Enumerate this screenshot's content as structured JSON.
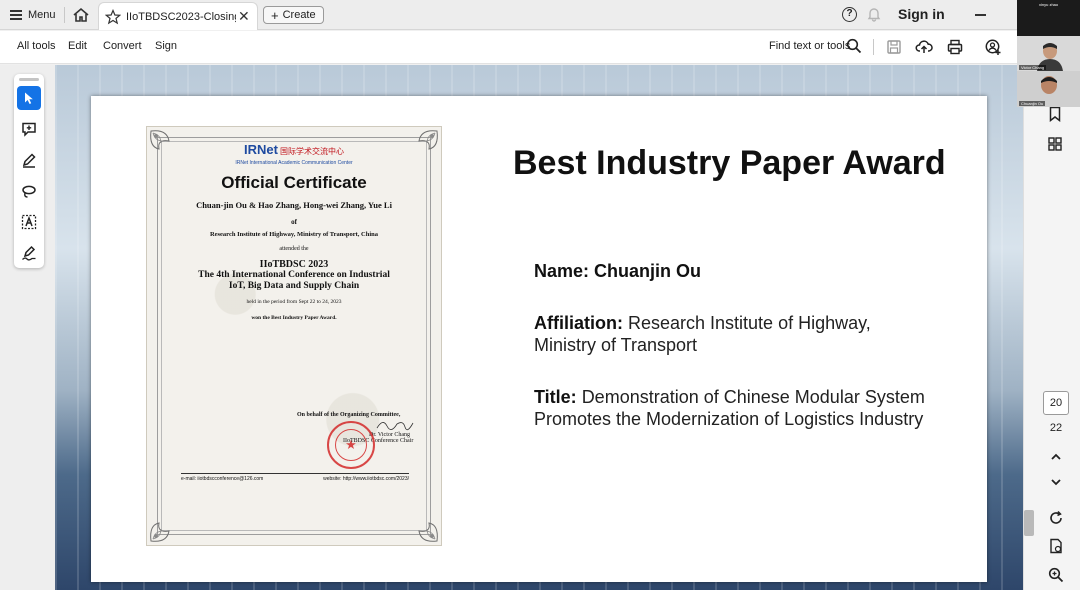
{
  "tabbar": {
    "menu_label": "Menu",
    "tab_title": "IIoTBDSC2023-Closing C...",
    "create_label": "Create",
    "signin_label": "Sign in"
  },
  "toolsbar": {
    "items": [
      "All tools",
      "Edit",
      "Convert",
      "Sign"
    ],
    "find_label": "Find text or tools"
  },
  "certificate": {
    "brand": "IRNet",
    "brand_cn": "国际学术交流中心",
    "brand_sub": "IRNet International Academic Communication Center",
    "title": "Official Certificate",
    "authors": "Chuan-jin Ou & Hao Zhang, Hong-wei Zhang, Yue Li",
    "of": "of",
    "institution": "Research Institute of Highway, Ministry of Transport, China",
    "attended": "attended the",
    "conf_short": "IIoTBDSC 2023",
    "conf_line1": "The 4th International Conference on Industrial",
    "conf_line2": "IoT, Big Data and Supply Chain",
    "held": "held in the period from Sept 22 to 24, 2023",
    "won": "won the Best Industry Paper Award.",
    "behalf": "On behalf of the Organizing Committee,",
    "signer": "Dr. Victor Chang",
    "signer_role": "IIoTBDSC Conference Chair",
    "email": "e-mail: iiotbdscconference@126.com",
    "website": "website: http://www.iiotbdsc.com/2023/"
  },
  "award": {
    "title": "Best Industry Paper Award",
    "name_label": "Name:",
    "name_value": "Chuanjin Ou",
    "affiliation_label": "Affiliation:",
    "affiliation_line1": "Research Institute of Highway,",
    "affiliation_line2": "Ministry of Transport",
    "title_label": "Title:",
    "title_line1": "Demonstration of Chinese Modular System",
    "title_line2": "Promotes the Modernization of Logistics Industry"
  },
  "pagination": {
    "current": "20",
    "total": "22"
  },
  "video": {
    "tile1_name": "xinyu zhao",
    "tile2_name": "Victor Chang",
    "tile3_name": "Chuanjin Ou"
  },
  "colors": {
    "accent": "#1473e6",
    "award_text": "#111111",
    "seal": "#d42a2a",
    "brand_blue": "#1e4aa0"
  }
}
